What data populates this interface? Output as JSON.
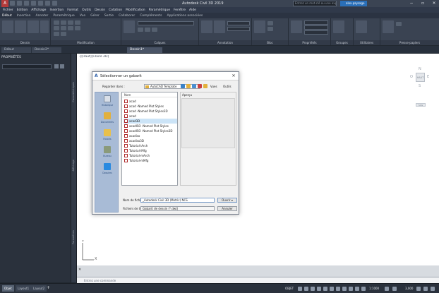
{
  "app": {
    "title": "Autodesk Civil 3D 2019",
    "search_placeholder": "Entrez un mot-clé ou une expression",
    "user": "alex.paysage"
  },
  "menubar": [
    "Fichier",
    "Edition",
    "Affichage",
    "Insertion",
    "Format",
    "Outils",
    "Dessin",
    "Cotation",
    "Modification",
    "Paramétrique",
    "Fenêtre",
    "Aide"
  ],
  "ribbon_tabs": [
    "Début",
    "Insertion",
    "Annoter",
    "Paramétrique",
    "Vue",
    "Gérer",
    "Sortie",
    "Collaborer",
    "Compléments",
    "Applications associées"
  ],
  "ribbon_panels": [
    "Dessin",
    "Modification",
    "Calques",
    "Annotation",
    "Bloc",
    "Propriétés",
    "Groupes",
    "Utilitaires",
    "Presse-papiers"
  ],
  "file_tabs": [
    "Début",
    "Dessin2*",
    "Dessin1*"
  ],
  "palette": {
    "title": "PROPRIÉTÉS",
    "side_labels": [
      "Caractéristiques",
      "Affichage",
      "Paramètres"
    ]
  },
  "viewport": {
    "label": "-][Haut][Filaire 2D]",
    "viewcube_face": "HAUT",
    "viewcube_n": "N",
    "viewcube_s": "S",
    "viewcube_o": "O",
    "viewcube_e": "E",
    "wcs": "SCG",
    "ucs_y": "Y",
    "ucs_x": "X"
  },
  "dialog": {
    "title": "Sélectionner un gabarit",
    "look_in_label": "Regarder dans :",
    "look_in_value": "AutoCAD Template",
    "views_label": "Vues",
    "tools_label": "Outils",
    "name_header": "Nom",
    "preview_label": "Aperçu",
    "places": [
      "Historique",
      "Documents",
      "Favoris",
      "Bureau",
      "Dossiers"
    ],
    "files": [
      "acad",
      "acad -Named Plot Styles",
      "acad -Named Plot Styles3D",
      "acad",
      "acad3D",
      "acadISO -Named Plot Styles",
      "acadISO -Named Plot Styles3D",
      "acadiso",
      "acadiso3D",
      "Tutorial-iArch",
      "Tutorial-iMfg",
      "Tutorial-mArch",
      "Tutorial-mMfg"
    ],
    "selected_index": 4,
    "filename_label": "Nom de fichier :",
    "filename_value": "_Autodesk Civil 3D (Metric) NCS",
    "filetype_label": "Fichiers de type :",
    "filetype_value": "Gabarit de dessin (*.dwt)",
    "open_label": "Ouvrir",
    "cancel_label": "Annuler"
  },
  "command": {
    "prompt": "Entrez une commande"
  },
  "statusbar": {
    "layout_tabs": [
      "Objet",
      "Layout1",
      "Layout2"
    ],
    "model": "OBJET",
    "scale": "1:1000",
    "units": "3,000"
  },
  "colors": {
    "title_bar": "#3b4453",
    "accent": "#2a6fb8",
    "dialog_bg": "#f0f0f0",
    "places_bg": "#a8bbd6"
  }
}
